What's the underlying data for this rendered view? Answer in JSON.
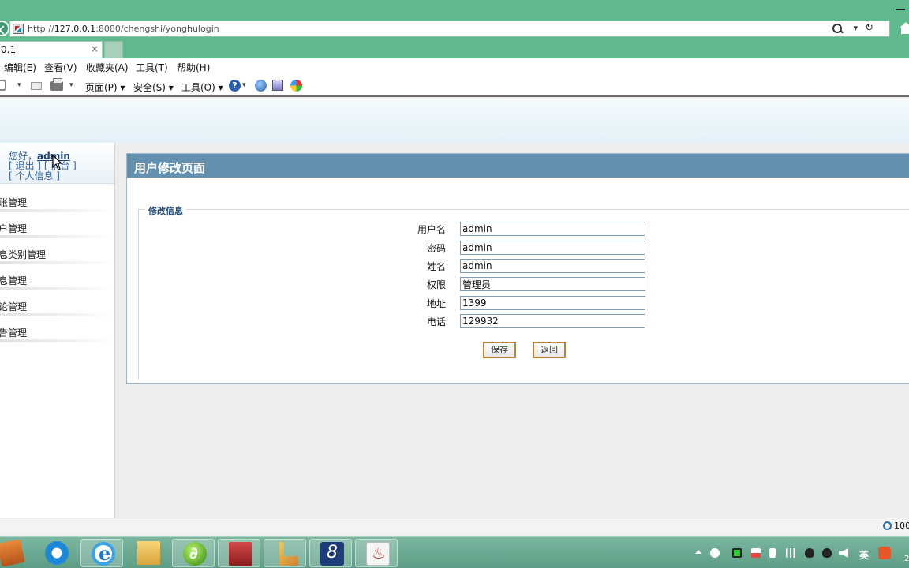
{
  "browser": {
    "url_prefix": "http://",
    "url_host": "127.0.0.1",
    "url_rest": ":8080/chengshi/yonghulogin",
    "dropdown_glyph": "▾",
    "refresh_glyph": "↻",
    "tab_label": "0.1",
    "tab_close": "×"
  },
  "menu": {
    "edit": "编辑(E)",
    "view": "查看(V)",
    "favorites": "收藏夹(A)",
    "tools": "工具(T)",
    "help": "帮助(H)"
  },
  "commands": {
    "page": "页面(P) ▾",
    "safety": "安全(S) ▾",
    "tools": "工具(O) ▾",
    "help_glyph": "?",
    "dd": "▾"
  },
  "sidebar": {
    "greeting": "您好，",
    "username": "admin",
    "logout": "[ 退出 ]",
    "frontend": "[ 前台 ]",
    "profile": "[ 个人信息 ]",
    "items": [
      {
        "label": "账管理"
      },
      {
        "label": "户管理"
      },
      {
        "label": "息类别管理"
      },
      {
        "label": "息管理"
      },
      {
        "label": "论管理"
      },
      {
        "label": "告管理"
      }
    ]
  },
  "main": {
    "title": "用户修改页面",
    "legend": "修改信息",
    "fields": [
      {
        "label": "用户名",
        "value": "admin"
      },
      {
        "label": "密码",
        "value": "admin"
      },
      {
        "label": "姓名",
        "value": "admin"
      },
      {
        "label": "权限",
        "value": "管理员"
      },
      {
        "label": "地址",
        "value": "1399"
      },
      {
        "label": "电话",
        "value": "129932"
      }
    ],
    "save_label": "保存",
    "back_label": "返回"
  },
  "status": {
    "zoom": "100"
  },
  "tray": {
    "ime": "英",
    "clock": "2"
  },
  "colors": {
    "chrome": "#5fb98c",
    "title_bar": "#6390ae",
    "button_border": "#b8872e"
  }
}
